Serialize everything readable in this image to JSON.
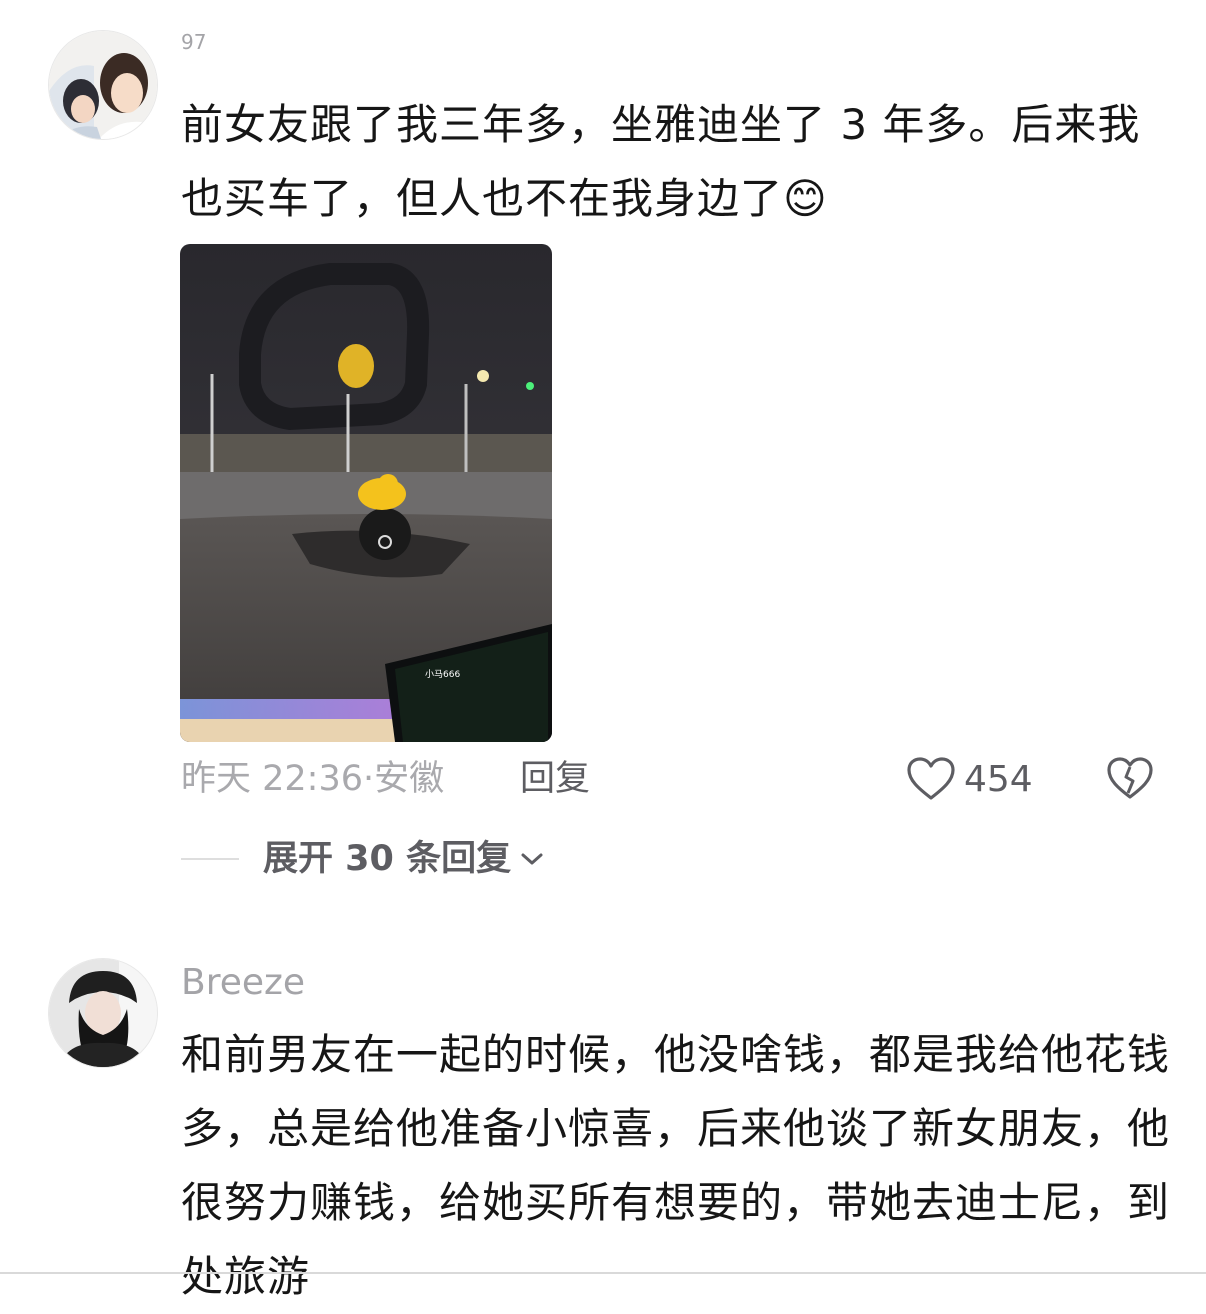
{
  "comments": [
    {
      "username": "97",
      "text": "前女友跟了我三年多，坐雅迪坐了 3 年多。后来我也买车了，但人也不在我身边了😊",
      "time": "昨天 22:36",
      "location": "安徽",
      "meta_sep": "·",
      "reply_label": "回复",
      "likes": "454",
      "expand_label": "展开 30 条回复",
      "photo_screen_label": "小马666"
    },
    {
      "username": "Breeze",
      "text": "和前男友在一起的时候，他没啥钱，都是我给他花钱多，总是给他准备小惊喜，后来他谈了新女朋友，他很努力赚钱，给她买所有想要的，带她去迪士尼，到处旅游"
    }
  ],
  "colors": {
    "text": "#161616",
    "muted": "#a9a9ad",
    "action": "#5d5d62"
  }
}
